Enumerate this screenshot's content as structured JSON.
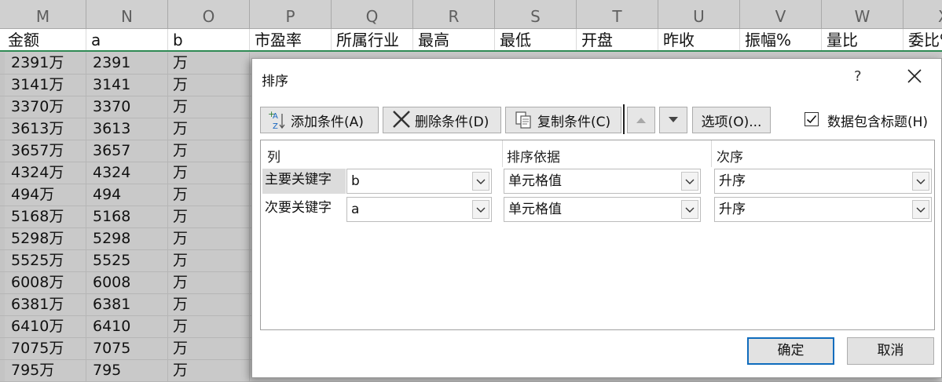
{
  "spreadsheet": {
    "column_letters": [
      "M",
      "N",
      "O",
      "P",
      "Q",
      "R",
      "S",
      "T",
      "U",
      "V",
      "W",
      "X"
    ],
    "header_row": [
      "金额",
      "a",
      "b",
      "市盈率",
      "所属行业",
      "最高",
      "最低",
      "开盘",
      "昨收",
      "振幅%",
      "量比",
      "委比%"
    ],
    "rows": [
      [
        "2391万",
        "2391",
        "万"
      ],
      [
        "3141万",
        "3141",
        "万"
      ],
      [
        "3370万",
        "3370",
        "万"
      ],
      [
        "3613万",
        "3613",
        "万"
      ],
      [
        "3657万",
        "3657",
        "万"
      ],
      [
        "4324万",
        "4324",
        "万"
      ],
      [
        "494万",
        "494",
        "万"
      ],
      [
        "5168万",
        "5168",
        "万"
      ],
      [
        "5298万",
        "5298",
        "万"
      ],
      [
        "5525万",
        "5525",
        "万"
      ],
      [
        "6008万",
        "6008",
        "万"
      ],
      [
        "6381万",
        "6381",
        "万"
      ],
      [
        "6410万",
        "6410",
        "万"
      ],
      [
        "7075万",
        "7075",
        "万"
      ],
      [
        "795万",
        "795",
        "万"
      ]
    ],
    "colors": {
      "grid_bg": "#c9c9c9",
      "header_line": "#2f8a54"
    }
  },
  "dialog": {
    "title": "排序",
    "help": "?",
    "toolbar": {
      "add_condition": "添加条件(A)",
      "delete_condition": "删除条件(D)",
      "copy_condition": "复制条件(C)",
      "move_up_icon": "triangle-up",
      "move_down_icon": "triangle-down",
      "options": "选项(O)..."
    },
    "has_headers": {
      "label": "数据包含标题(H)",
      "checked": true
    },
    "grid": {
      "col_header": "列",
      "sort_on_header": "排序依据",
      "order_header": "次序",
      "levels": [
        {
          "label": "主要关键字",
          "column": "b",
          "sort_on": "单元格值",
          "order": "升序"
        },
        {
          "label": "次要关键字",
          "column": "a",
          "sort_on": "单元格值",
          "order": "升序"
        }
      ]
    },
    "ok_label": "确定",
    "cancel_label": "取消",
    "colors": {
      "accent": "#0f6cbd"
    }
  }
}
